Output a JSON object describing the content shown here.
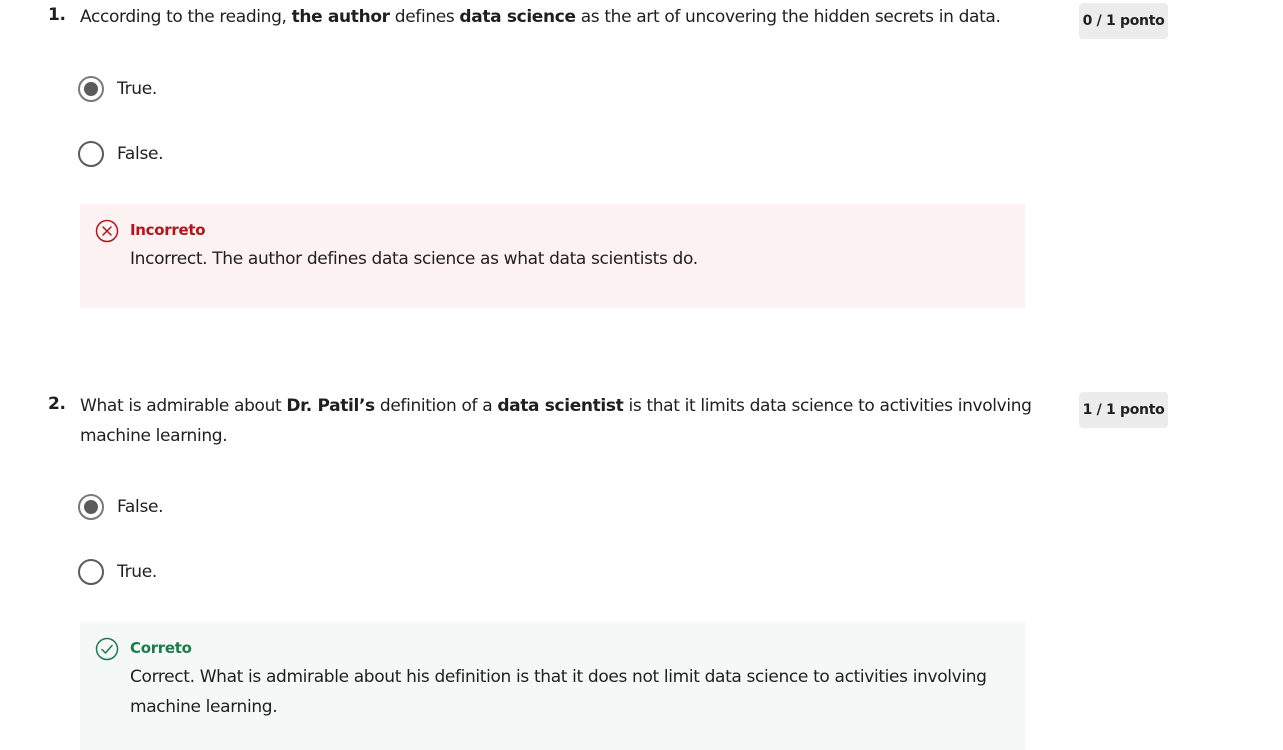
{
  "questions": [
    {
      "number": "1.",
      "text_parts": {
        "p1": "According to the reading, ",
        "b1": "the author",
        "p2": " defines ",
        "b2": "data science",
        "p3": " as the art of uncovering the hidden secrets in data."
      },
      "score": "0 / 1 ponto",
      "options": [
        {
          "label": "True.",
          "selected": true
        },
        {
          "label": "False.",
          "selected": false
        }
      ],
      "feedback": {
        "status": "incorrect",
        "title": "Incorreto",
        "text": "Incorrect. The author defines data science as what data scientists do.",
        "color": "#b3131c",
        "icon": "x-circle-icon"
      }
    },
    {
      "number": "2.",
      "text_parts": {
        "p1": "What is admirable about ",
        "b1": "Dr. Patil’s",
        "p2": " definition of a ",
        "b2": "data scientist",
        "p3": " is that it limits data science to activities involving machine learning."
      },
      "score": "1 / 1 ponto",
      "options": [
        {
          "label": "False.",
          "selected": true
        },
        {
          "label": "True.",
          "selected": false
        }
      ],
      "feedback": {
        "status": "correct",
        "title": "Correto",
        "text": "Correct. What is admirable about his definition is that it does not limit data science to activities involving machine learning.",
        "color": "#1d7a4a",
        "icon": "check-circle-icon"
      }
    }
  ]
}
